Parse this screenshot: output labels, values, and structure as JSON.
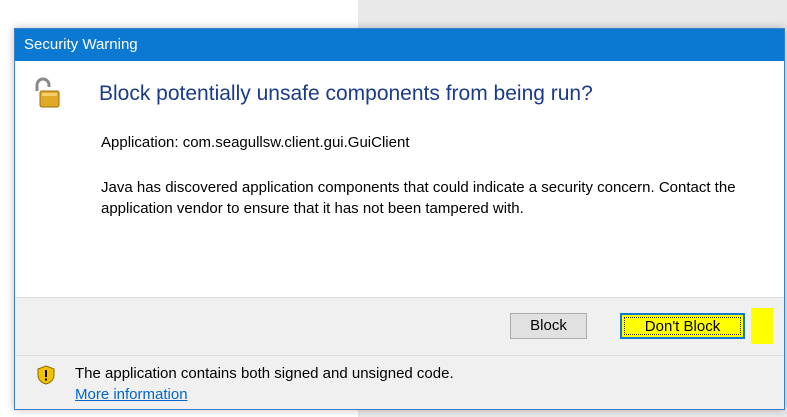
{
  "dialog": {
    "title": "Security Warning",
    "heading": "Block potentially unsafe components from being run?",
    "application_line": "Application: com.seagullsw.client.gui.GuiClient",
    "description": "Java has discovered application components that could indicate a security concern. Contact the application vendor to ensure that it has not been tampered with.",
    "buttons": {
      "block": "Block",
      "dont_block": "Don't Block"
    },
    "footer": {
      "message": "The application contains both signed and unsigned code.",
      "link": "More information"
    }
  },
  "colors": {
    "titlebar": "#0b78d1",
    "heading_text": "#1a3a8a",
    "highlight": "#ffff00",
    "link": "#0066cc"
  },
  "icons": {
    "header": "unlocked-padlock-icon",
    "footer": "warning-shield-icon"
  }
}
